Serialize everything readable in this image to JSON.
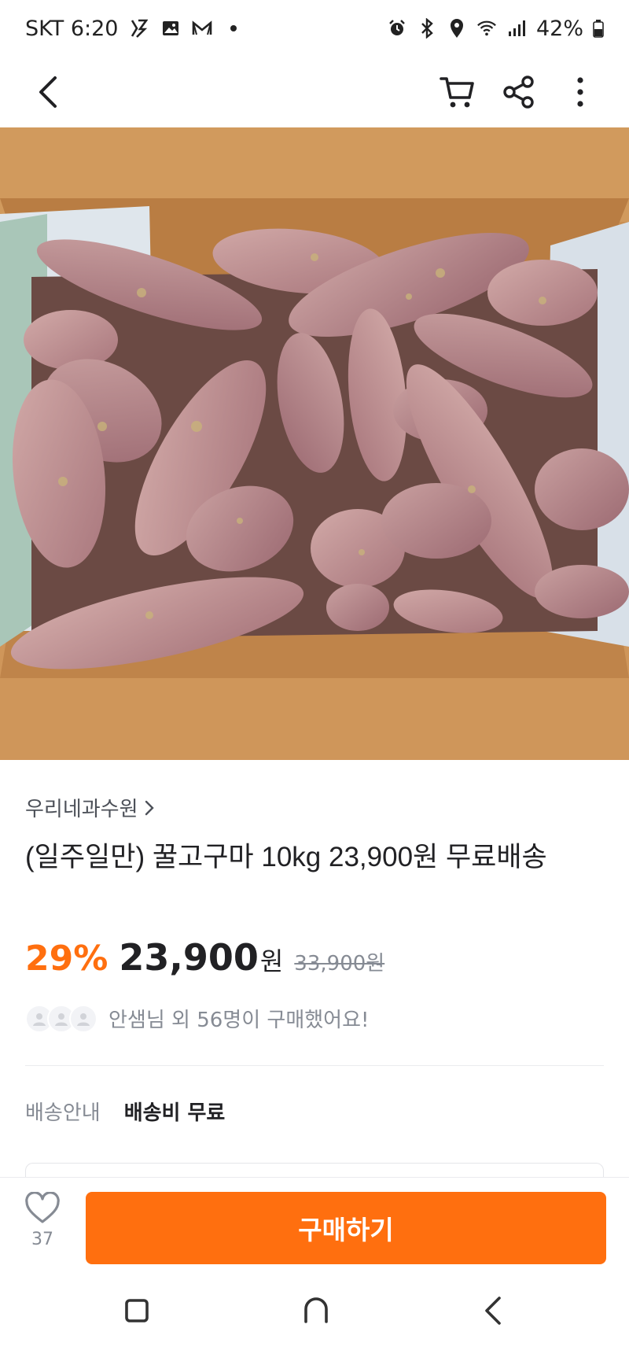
{
  "status_bar": {
    "carrier_time": "SKT 6:20",
    "battery": "42%",
    "left_icons": [
      "flash-icon",
      "gallery-icon",
      "gmail-icon",
      "dot-icon"
    ],
    "right_icons": [
      "alarm-icon",
      "bluetooth-icon",
      "location-icon",
      "wifi-icon",
      "signal-icon",
      "battery-icon"
    ]
  },
  "app_bar": {
    "icons": [
      "back-icon",
      "cart-icon",
      "share-icon",
      "more-icon"
    ]
  },
  "product": {
    "seller": "우리네과수원",
    "title": "(일주일만) 꿀고구마 10kg 23,900원 무료배송",
    "discount": "29%",
    "price": "23,900",
    "currency": "원",
    "original_price": "33,900원",
    "buyers_text": "안샘님 외 56명이 구매했어요!"
  },
  "shipping": {
    "label": "배송안내",
    "value": "배송비 무료"
  },
  "bottom_bar": {
    "like_count": "37",
    "buy_label": "구매하기"
  },
  "colors": {
    "accent": "#ff6f0f",
    "text": "#212124",
    "muted": "#868b94"
  }
}
